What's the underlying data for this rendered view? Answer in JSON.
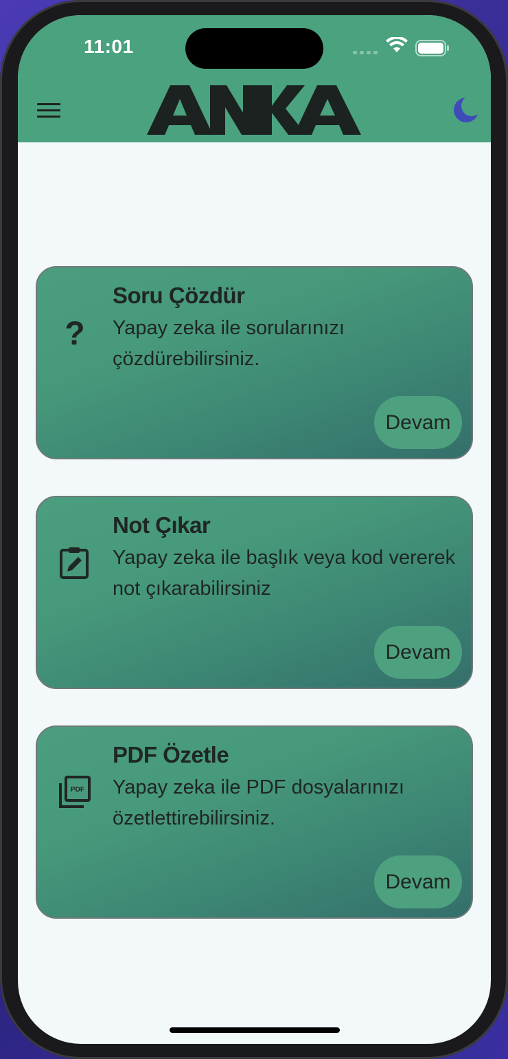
{
  "status_bar": {
    "time": "11:01"
  },
  "app": {
    "logo_text": "ANKA"
  },
  "cards": [
    {
      "title": "Soru Çözdür",
      "description": "Yapay zeka ile sorularınızı çözdürebilirsiniz.",
      "button": "Devam",
      "icon": "question-mark-icon"
    },
    {
      "title": "Not Çıkar",
      "description": "Yapay zeka ile başlık veya kod vererek not çıkarabilirsiniz",
      "button": "Devam",
      "icon": "clipboard-edit-icon"
    },
    {
      "title": "PDF Özetle",
      "description": "Yapay zeka ile PDF dosyalarınızı özetlettirebilirsiniz.",
      "button": "Devam",
      "icon": "pdf-stack-icon"
    }
  ],
  "colors": {
    "appbar": "#4aa27f",
    "card_start": "#4a9e7e",
    "card_end": "#346f6b",
    "button": "#4ea17f",
    "moon": "#3f4bb8",
    "background": "#f3f9fa"
  }
}
